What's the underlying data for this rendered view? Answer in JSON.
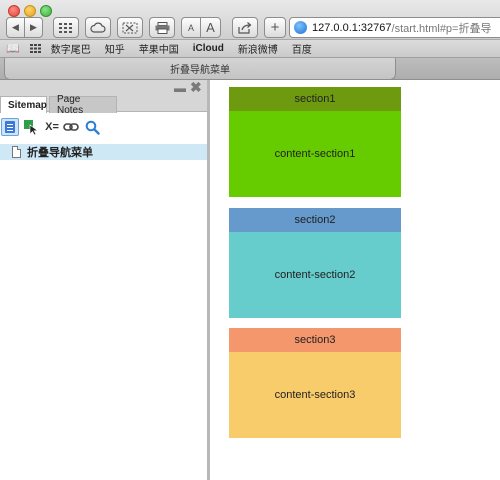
{
  "window": {
    "tab_title": "折叠导航菜单"
  },
  "toolbar": {
    "back_glyph": "◀",
    "forward_glyph": "▶",
    "font_small": "A",
    "font_large": "A",
    "add_glyph": "+",
    "url_host": "127.0.0.1:32767",
    "url_rest": "/start.html#p=折叠导"
  },
  "bookmarks": {
    "items": [
      {
        "label": "数字尾巴",
        "bold": false
      },
      {
        "label": "知乎",
        "bold": false
      },
      {
        "label": "苹果中国",
        "bold": false
      },
      {
        "label": "iCloud",
        "bold": true
      },
      {
        "label": "新浪微博",
        "bold": false
      },
      {
        "label": "百度",
        "bold": false
      }
    ]
  },
  "sidebar": {
    "tabs": [
      {
        "label": "Sitemap",
        "active": true
      },
      {
        "label": "Page Notes",
        "active": false
      }
    ],
    "minimize_glyph": "▬",
    "close_glyph": "✖",
    "variables_label": "X=",
    "pages": [
      {
        "label": "折叠导航菜单",
        "selected": true
      }
    ]
  },
  "sections": [
    {
      "header": "section1",
      "content": "content-section1",
      "header_color": "#6d9a0e",
      "body_color": "#66cc00"
    },
    {
      "header": "section2",
      "content": "content-section2",
      "header_color": "#6699cc",
      "body_color": "#66cccc"
    },
    {
      "header": "section3",
      "content": "content-section3",
      "header_color": "#f4976c",
      "body_color": "#f9cc6b"
    }
  ]
}
